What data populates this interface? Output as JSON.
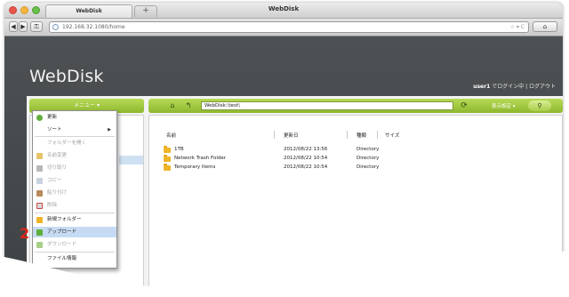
{
  "window": {
    "title": "WebDisk"
  },
  "browser": {
    "tab_label": "WebDisk",
    "new_tab": "+",
    "url": "192.168.32.1080/home",
    "back": "◀",
    "forward": "▶",
    "url_tools": "☆ ▾ C",
    "home": "⌂"
  },
  "app": {
    "logo": "WebDisk",
    "user_name": "user1",
    "user_status": " でログイン中 | ログアウト"
  },
  "menu": {
    "label": "メニュー ▾"
  },
  "context_menu": {
    "items": [
      {
        "label": "更新",
        "enabled": true,
        "icon": "refresh-icon"
      },
      {
        "label": "ソート",
        "enabled": true,
        "icon": "",
        "submenu": "▶"
      },
      {
        "label": "フォルダーを開く",
        "enabled": false,
        "icon": ""
      },
      {
        "label": "名前変更",
        "enabled": false,
        "icon": "rename-icon"
      },
      {
        "label": "切り取り",
        "enabled": false,
        "icon": "cut-icon"
      },
      {
        "label": "コピー",
        "enabled": false,
        "icon": "copy-icon"
      },
      {
        "label": "貼り付け",
        "enabled": false,
        "icon": "paste-icon"
      },
      {
        "label": "削除",
        "enabled": false,
        "icon": "delete-icon"
      },
      {
        "label": "新規フォルダー",
        "enabled": true,
        "icon": "new-folder-icon"
      },
      {
        "label": "アップロード",
        "enabled": true,
        "icon": "upload-icon"
      },
      {
        "label": "ダウンロード",
        "enabled": false,
        "icon": "download-icon"
      },
      {
        "label": "ファイル情報",
        "enabled": true,
        "icon": ""
      }
    ]
  },
  "toolbar": {
    "home_icon": "⌂",
    "up_icon": "↰",
    "path": "WebDisk:\\test\\",
    "refresh_icon": "⟳",
    "display_settings": "表示設定 ▾",
    "search_icon": "⚲"
  },
  "file_list": {
    "headers": {
      "name": "名前",
      "modified": "更新日",
      "type": "種類",
      "size": "サイズ"
    },
    "rows": [
      {
        "name": "1TB",
        "modified": "2012/08/22 13:56",
        "type": "Directory"
      },
      {
        "name": "Network Trash Folder",
        "modified": "2012/08/22 10:54",
        "type": "Directory"
      },
      {
        "name": "Temporary Items",
        "modified": "2012/08/22 10:54",
        "type": "Directory"
      }
    ]
  },
  "annotation": {
    "step": "2"
  },
  "colors": {
    "accent_green": "#9ec73d",
    "highlight": "#c6dbf3",
    "step_red": "#d9261c"
  }
}
